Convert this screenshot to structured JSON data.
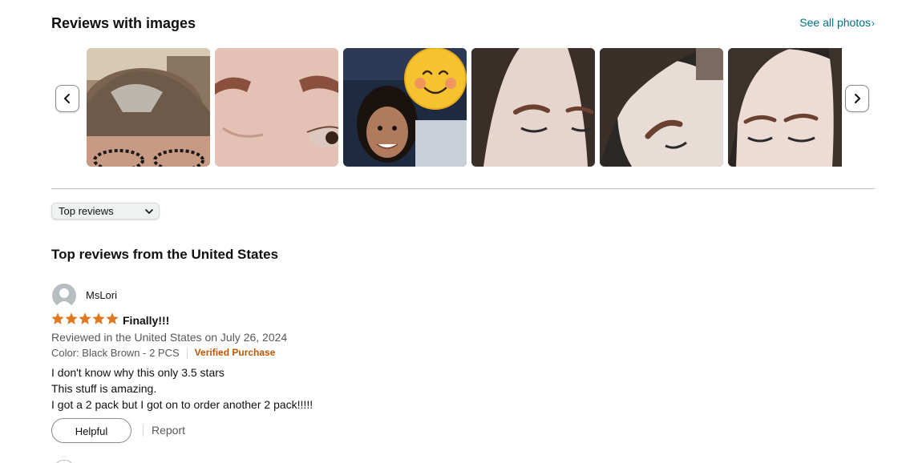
{
  "gallery": {
    "title": "Reviews with images",
    "see_all_label": "See all photos",
    "see_all_chevron": "›",
    "images": [
      {
        "label": "customer image 1"
      },
      {
        "label": "customer image 2"
      },
      {
        "label": "customer image 3"
      },
      {
        "label": "customer image 4"
      },
      {
        "label": "customer image 5"
      },
      {
        "label": "customer image 6"
      }
    ]
  },
  "sort": {
    "selected": "Top reviews"
  },
  "reviews_heading": "Top reviews from the United States",
  "review": {
    "author": "MsLori",
    "rating": 5,
    "rating_max": 5,
    "title": "Finally!!!",
    "date_line": "Reviewed in the United States on July 26, 2024",
    "variant": "Color: Black Brown - 2 PCS",
    "verified": "Verified Purchase",
    "body": [
      "I don't know why this only 3.5 stars",
      "This stuff is amazing.",
      "I got a 2 pack but I got on to order another 2 pack!!!!!"
    ],
    "helpful_label": "Helpful",
    "report_label": "Report"
  },
  "colors": {
    "star": "#de7921",
    "link": "#007185",
    "verified": "#c45500",
    "muted": "#565959"
  }
}
